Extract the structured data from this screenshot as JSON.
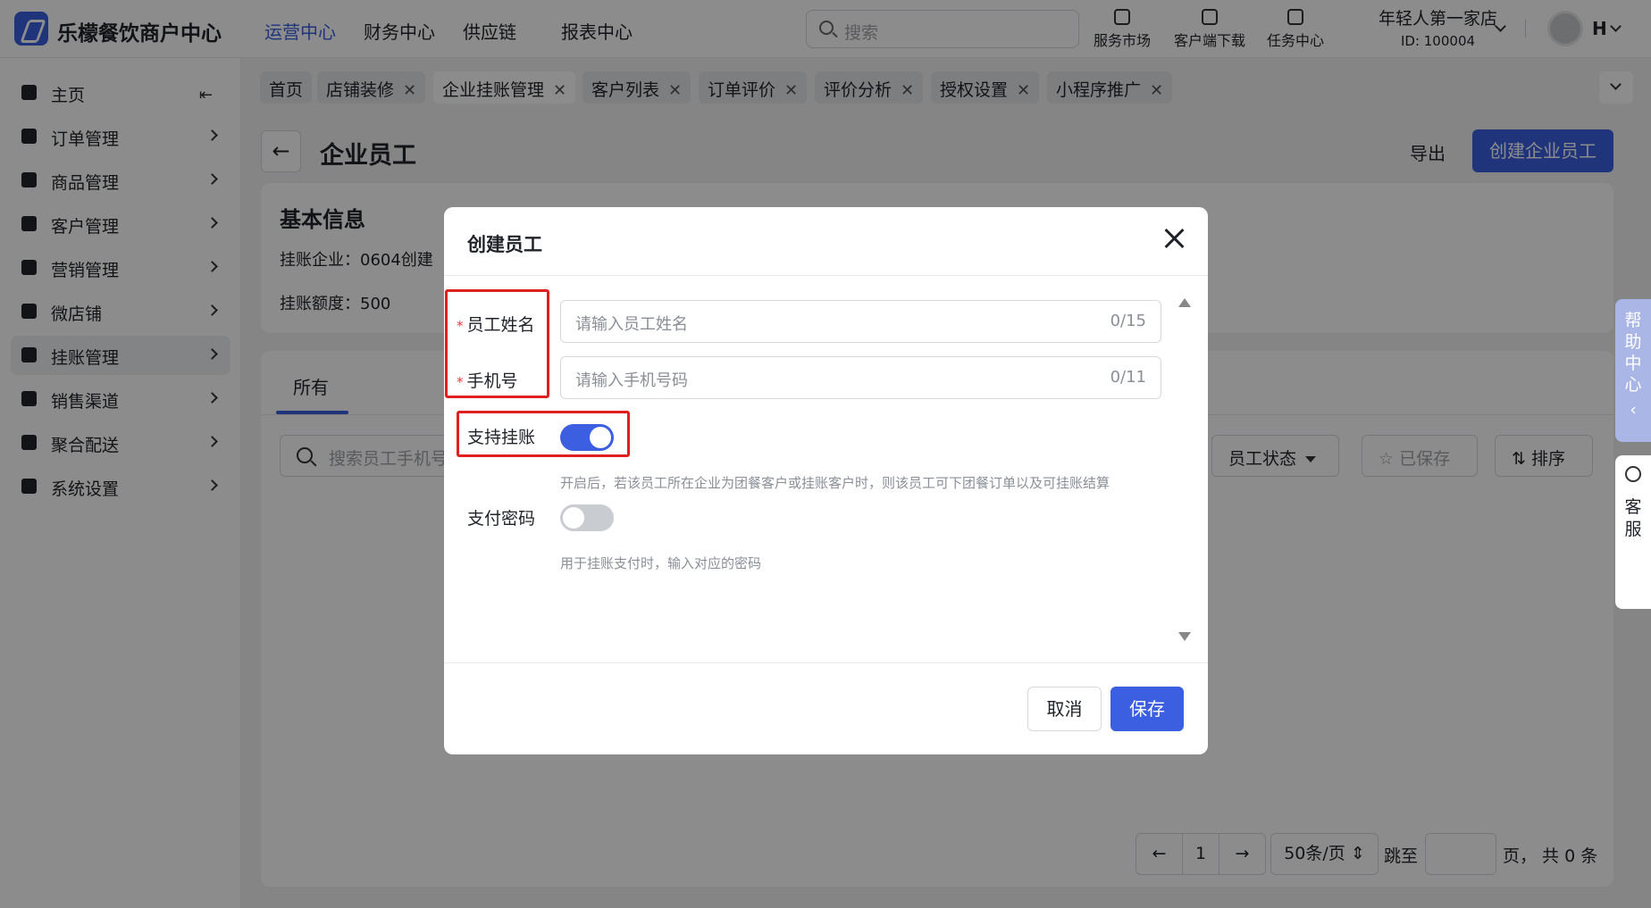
{
  "app": {
    "brand": "乐檬餐饮商户中心"
  },
  "topnav": [
    "运营中心",
    "财务中心",
    "供应链",
    "报表中心"
  ],
  "search": {
    "placeholder": "搜索"
  },
  "tools": [
    "服务市场",
    "客户端下载",
    "任务中心"
  ],
  "store": {
    "name": "年轻人第一家店",
    "id": "ID: 100004"
  },
  "user": {
    "initial": "H"
  },
  "sidebar": {
    "items": [
      {
        "label": "主页"
      },
      {
        "label": "订单管理"
      },
      {
        "label": "商品管理"
      },
      {
        "label": "客户管理"
      },
      {
        "label": "营销管理"
      },
      {
        "label": "微店铺"
      },
      {
        "label": "挂账管理"
      },
      {
        "label": "销售渠道"
      },
      {
        "label": "聚合配送"
      },
      {
        "label": "系统设置"
      }
    ]
  },
  "tabs": [
    "首页",
    "店铺装修",
    "企业挂账管理",
    "客户列表",
    "订单评价",
    "评价分析",
    "授权设置",
    "小程序推广"
  ],
  "page": {
    "title": "企业员工",
    "export": "导出",
    "create": "创建企业员工"
  },
  "basic": {
    "title": "基本信息",
    "company": "挂账企业：0604创建",
    "limit": "挂账额度：500"
  },
  "list": {
    "tab_all": "所有",
    "search_placeholder": "搜索员工手机号",
    "status_filter": "员工状态",
    "saved": "已保存",
    "sort": "排序"
  },
  "pagination": {
    "page": "1",
    "page_size": "50条/页",
    "jump": "跳至",
    "total": "页， 共 0 条"
  },
  "floating": {
    "help": "帮助中心",
    "service": "客服"
  },
  "modal": {
    "title": "创建员工",
    "name_label": "员工姓名",
    "name_placeholder": "请输入员工姓名",
    "name_count": "0/15",
    "phone_label": "手机号",
    "phone_placeholder": "请输入手机号码",
    "phone_count": "0/11",
    "credit_label": "支持挂账",
    "credit_enabled": true,
    "credit_hint": "开启后，若该员工所在企业为团餐客户或挂账客户时，则该员工可下团餐订单以及可挂账结算",
    "pwd_label": "支付密码",
    "pwd_enabled": false,
    "pwd_hint": "用于挂账支付时，输入对应的密码",
    "cancel": "取消",
    "save": "保存"
  },
  "colors": {
    "accent": "#3b5fe0",
    "highlight": "#e02020"
  }
}
